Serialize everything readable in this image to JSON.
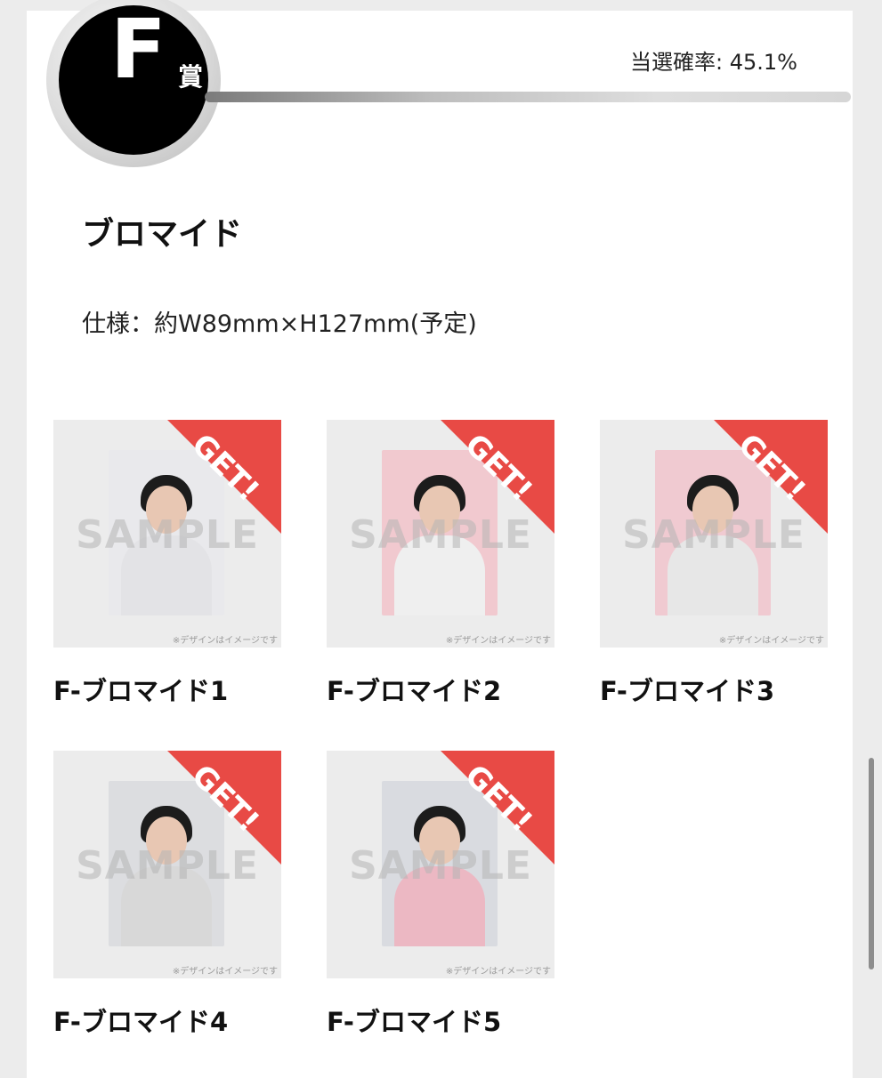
{
  "prize": {
    "letter": "F",
    "suffix": "賞",
    "rate": "当選確率: 45.1%"
  },
  "section": {
    "title": "ブロマイド",
    "spec": "仕様：約W89mm×H127mm(予定)"
  },
  "items": [
    {
      "label": "F-ブロマイド1",
      "badge": "GET!",
      "watermark": "SAMPLE",
      "note": "※デザインはイメージです",
      "bg": "#e9e9ec",
      "top": "#e2e2e2"
    },
    {
      "label": "F-ブロマイド2",
      "badge": "GET!",
      "watermark": "SAMPLE",
      "note": "※デザインはイメージです",
      "bg": "#f1c9cf",
      "top": "#efefef"
    },
    {
      "label": "F-ブロマイド3",
      "badge": "GET!",
      "watermark": "SAMPLE",
      "note": "※デザインはイメージです",
      "bg": "#f0cad1",
      "top": "#e7e7e7"
    },
    {
      "label": "F-ブロマイド4",
      "badge": "GET!",
      "watermark": "SAMPLE",
      "note": "※デザインはイメージです",
      "bg": "#dcdde0",
      "top": "#d8d8d8"
    },
    {
      "label": "F-ブロマイド5",
      "badge": "GET!",
      "watermark": "SAMPLE",
      "note": "※デザインはイメージです",
      "bg": "#d9dbe0",
      "top": "#ecb8c3"
    }
  ],
  "colors": {
    "accent": "#e84a45",
    "badge_bg": "#000000"
  }
}
